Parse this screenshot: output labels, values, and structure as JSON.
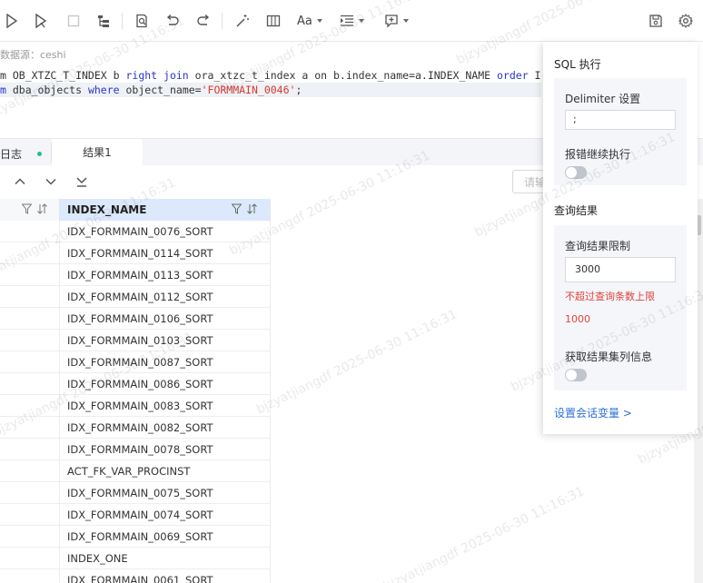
{
  "toolbar": {
    "font_label": "Aa"
  },
  "editor": {
    "datasource_label": "数据源：ceshi",
    "line1": {
      "p1": "m OB_XTZC_T_INDEX b ",
      "k1": "right join",
      "p2": " ora_xtzc_t_index a on b.index_name=a.INDEX_NAME ",
      "k2": "order",
      "p3": " I"
    },
    "line2": {
      "k1": "m",
      "p1": " dba_objects ",
      "k2": "where",
      "p2": " object_name=",
      "s1": "'FORMMAIN_0046'",
      "p3": ";"
    }
  },
  "results": {
    "tab_log": "日志",
    "tab_result": "结果1",
    "filter_placeholder": "请输"
  },
  "table": {
    "column": "INDEX_NAME",
    "rows": [
      "IDX_FORMMAIN_0076_SORT",
      "IDX_FORMMAIN_0114_SORT",
      "IDX_FORMMAIN_0113_SORT",
      "IDX_FORMMAIN_0112_SORT",
      "IDX_FORMMAIN_0106_SORT",
      "IDX_FORMMAIN_0103_SORT",
      "IDX_FORMMAIN_0087_SORT",
      "IDX_FORMMAIN_0086_SORT",
      "IDX_FORMMAIN_0083_SORT",
      "IDX_FORMMAIN_0082_SORT",
      "IDX_FORMMAIN_0078_SORT",
      "ACT_FK_VAR_PROCINST",
      "IDX_FORMMAIN_0075_SORT",
      "IDX_FORMMAIN_0074_SORT",
      "IDX_FORMMAIN_0069_SORT",
      "INDEX_ONE",
      "IDX_FORMMAIN_0061_SORT"
    ]
  },
  "settings": {
    "sql_exec_title": "SQL 执行",
    "delimiter_label": "Delimiter 设置",
    "delimiter_value": ";",
    "continue_on_error_label": "报错继续执行",
    "query_result_title": "查询结果",
    "result_limit_label": "查询结果限制",
    "result_limit_value": "3000",
    "limit_warning": "不超过查询条数上限",
    "limit_max": "1000",
    "column_info_label": "获取结果集列信息",
    "session_vars_link": "设置会话变量 >"
  },
  "watermark": {
    "text": "bjzyatjiangdf 2025-06-30 11:16:31"
  },
  "colors": {
    "accent": "#2f6fd8",
    "keyword": "#2a35c9",
    "string": "#d43a30",
    "warning": "#e0443a",
    "status_dot": "#20c08a",
    "header_selected": "#dce8fb"
  }
}
